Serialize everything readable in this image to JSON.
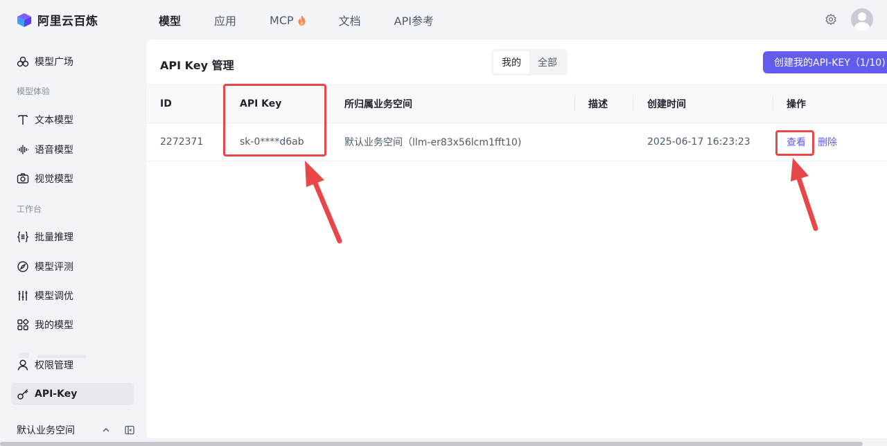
{
  "brand": {
    "name": "阿里云百炼"
  },
  "nav": {
    "items": [
      {
        "label": "模型",
        "active": true
      },
      {
        "label": "应用",
        "active": false
      },
      {
        "label": "MCP",
        "active": false,
        "icon": "flame-icon"
      },
      {
        "label": "文档",
        "active": false
      },
      {
        "label": "API参考",
        "active": false
      }
    ]
  },
  "sidebar": {
    "items": [
      {
        "label": "模型广场",
        "icon": "model-square-icon"
      },
      {
        "label": "文本模型",
        "icon": "text-icon"
      },
      {
        "label": "语音模型",
        "icon": "audio-wave-icon"
      },
      {
        "label": "视觉模型",
        "icon": "camera-icon"
      },
      {
        "label": "批量推理",
        "icon": "braces-icon"
      },
      {
        "label": "模型评测",
        "icon": "compass-icon"
      },
      {
        "label": "模型调优",
        "icon": "sliders-icon"
      },
      {
        "label": "我的模型",
        "icon": "grid-icon"
      },
      {
        "label": "权限管理",
        "icon": "user-icon"
      },
      {
        "label": "API-Key",
        "icon": "key-icon",
        "active": true
      }
    ],
    "groups": [
      "模型体验",
      "工作台"
    ],
    "workspace": "默认业务空间"
  },
  "page": {
    "title": "API Key 管理",
    "tabs": [
      "我的",
      "全部"
    ],
    "active_tab": "我的",
    "create_button": "创建我的API-KEY（1/10)"
  },
  "table": {
    "headers": [
      "ID",
      "API Key",
      "所归属业务空间",
      "描述",
      "创建时间",
      "操作"
    ],
    "rows": [
      {
        "id": "2272371",
        "api_key": "sk-0****d6ab",
        "workspace": "默认业务空间（llm-er83x56lcm1fft10)",
        "description": "",
        "created": "2025-06-17 16:23:23",
        "actions": [
          "查看",
          "删除"
        ]
      }
    ]
  },
  "colors": {
    "accent": "#615ced",
    "annotation": "#e8474a"
  }
}
